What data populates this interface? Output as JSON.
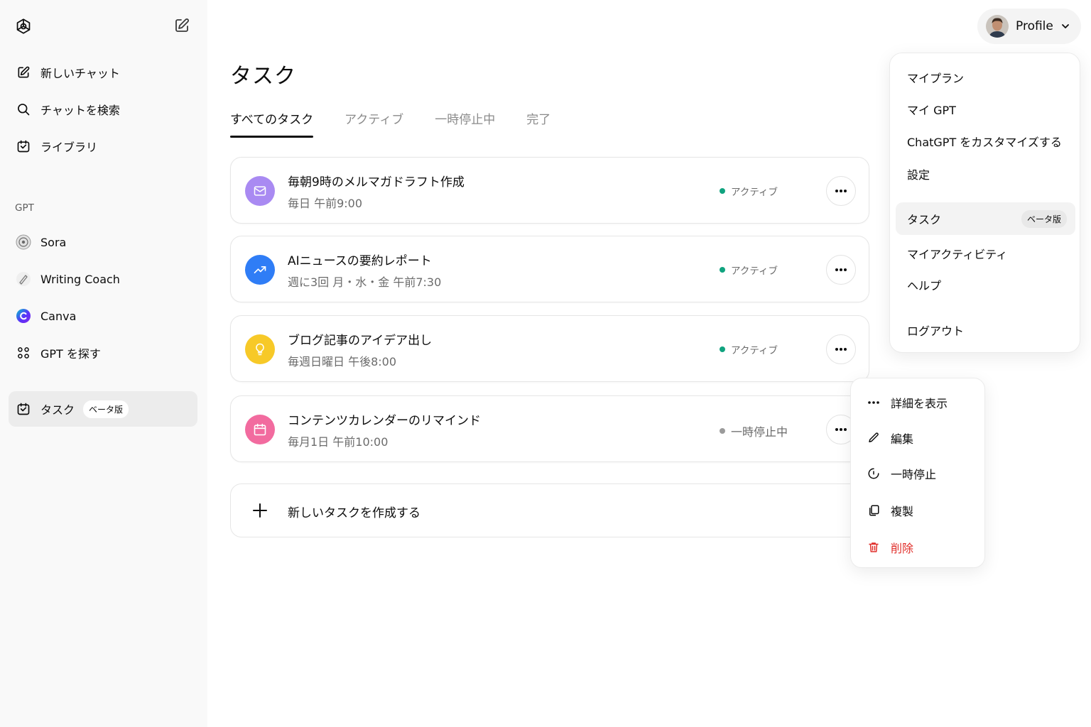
{
  "sidebar": {
    "nav": [
      {
        "label": "新しいチャット",
        "icon": "new-chat-icon"
      },
      {
        "label": "チャットを検索",
        "icon": "search-icon"
      },
      {
        "label": "ライブラリ",
        "icon": "library-icon"
      }
    ],
    "section_label": "GPT",
    "gpts": [
      {
        "label": "Sora",
        "icon": "sora-icon"
      },
      {
        "label": "Writing Coach",
        "icon": "writing-coach-icon"
      },
      {
        "label": "Canva",
        "icon": "canva-icon"
      },
      {
        "label": "GPT を探す",
        "icon": "grid-icon"
      }
    ],
    "tasks": {
      "label": "タスク",
      "badge": "ベータ版",
      "icon": "tasks-icon"
    }
  },
  "main": {
    "title": "タスク",
    "tabs": [
      {
        "label": "すべてのタスク",
        "active": true
      },
      {
        "label": "アクティブ",
        "active": false
      },
      {
        "label": "一時停止中",
        "active": false
      },
      {
        "label": "完了",
        "active": false
      }
    ],
    "tasks": [
      {
        "title": "毎朝9時のメルマガドラフト作成",
        "schedule": "毎日 午前9:00",
        "status": "アクティブ",
        "status_color": "#10a37f",
        "icon": "mail-icon",
        "icon_bg": "#a98af2"
      },
      {
        "title": "AIニュースの要約レポート",
        "schedule": "週に3回 月・水・金 午前7:30",
        "status": "アクティブ",
        "status_color": "#10a37f",
        "icon": "trend-icon",
        "icon_bg": "#2f7df6"
      },
      {
        "title": "ブログ記事のアイデア出し",
        "schedule": "毎週日曜日 午後8:00",
        "status": "アクティブ",
        "status_color": "#10a37f",
        "icon": "lightbulb-icon",
        "icon_bg": "#f7c928"
      },
      {
        "title": "コンテンツカレンダーのリマインド",
        "schedule": "毎月1日 午前10:00",
        "status": "一時停止中",
        "status_color": "#9b9b9b",
        "icon": "calendar-icon",
        "icon_bg": "#f26b9f"
      }
    ],
    "new_task_label": "新しいタスクを作成する"
  },
  "profile": {
    "label": "Profile",
    "menu": [
      {
        "label": "マイプラン"
      },
      {
        "label": "マイ GPT"
      },
      {
        "label": "ChatGPT をカスタマイズする"
      },
      {
        "label": "設定"
      },
      {
        "label": "タスク",
        "badge": "ベータ版",
        "highlighted": true
      },
      {
        "label": "マイアクティビティ"
      },
      {
        "label": "ヘルプ"
      },
      {
        "label": "ログアウト"
      }
    ]
  },
  "context_menu": {
    "items": [
      {
        "label": "詳細を表示",
        "icon": "more-icon"
      },
      {
        "label": "編集",
        "icon": "pencil-icon"
      },
      {
        "label": "一時停止",
        "icon": "pause-icon"
      },
      {
        "label": "複製",
        "icon": "duplicate-icon"
      },
      {
        "label": "削除",
        "icon": "trash-icon",
        "danger": true
      }
    ],
    "danger_color": "#e02e2a"
  }
}
